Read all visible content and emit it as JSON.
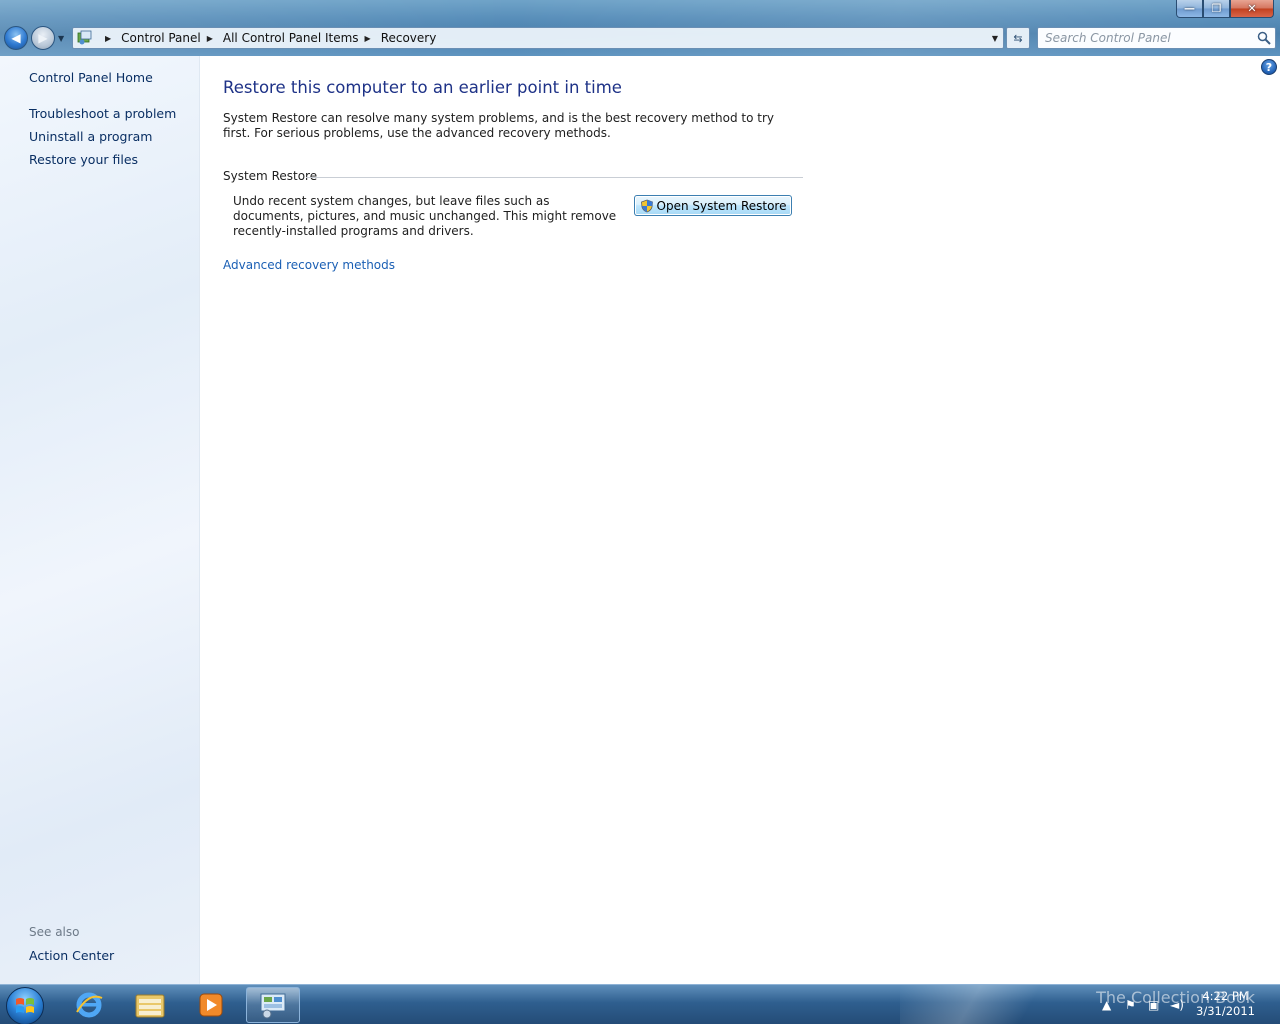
{
  "window": {
    "minimize_glyph": "—",
    "restore_glyph": "❐",
    "close_glyph": "✕"
  },
  "toolbar": {
    "breadcrumbs": [
      "Control Panel",
      "All Control Panel Items",
      "Recovery"
    ],
    "search_placeholder": "Search Control Panel"
  },
  "sidebar": {
    "items": [
      {
        "label": "Control Panel Home"
      },
      {
        "label": "Troubleshoot a problem"
      },
      {
        "label": "Uninstall a program"
      },
      {
        "label": "Restore your files"
      }
    ],
    "see_also_label": "See also",
    "see_also_items": [
      {
        "label": "Action Center"
      }
    ]
  },
  "main": {
    "title": "Restore this computer to an earlier point in time",
    "intro": "System Restore can resolve many system problems, and is the best recovery method to try first. For serious problems, use the advanced recovery methods.",
    "system_restore": {
      "group_label": "System Restore",
      "description": "Undo recent system changes, but leave files such as documents, pictures, and music unchanged. This might remove recently-installed programs and drivers.",
      "button_label": "Open System Restore"
    },
    "advanced_link": "Advanced recovery methods"
  },
  "taskbar": {
    "apps": [
      "start-orb",
      "internet-explorer-icon",
      "windows-explorer-icon",
      "media-player-icon",
      "control-panel-icon"
    ],
    "watermark": "The Collection Book",
    "time": "4:22 PM",
    "date": "3/31/2011"
  },
  "colors": {
    "title_blue": "#1e3287",
    "link_blue": "#1a5fb4",
    "nav_link": "#0a2f63"
  }
}
